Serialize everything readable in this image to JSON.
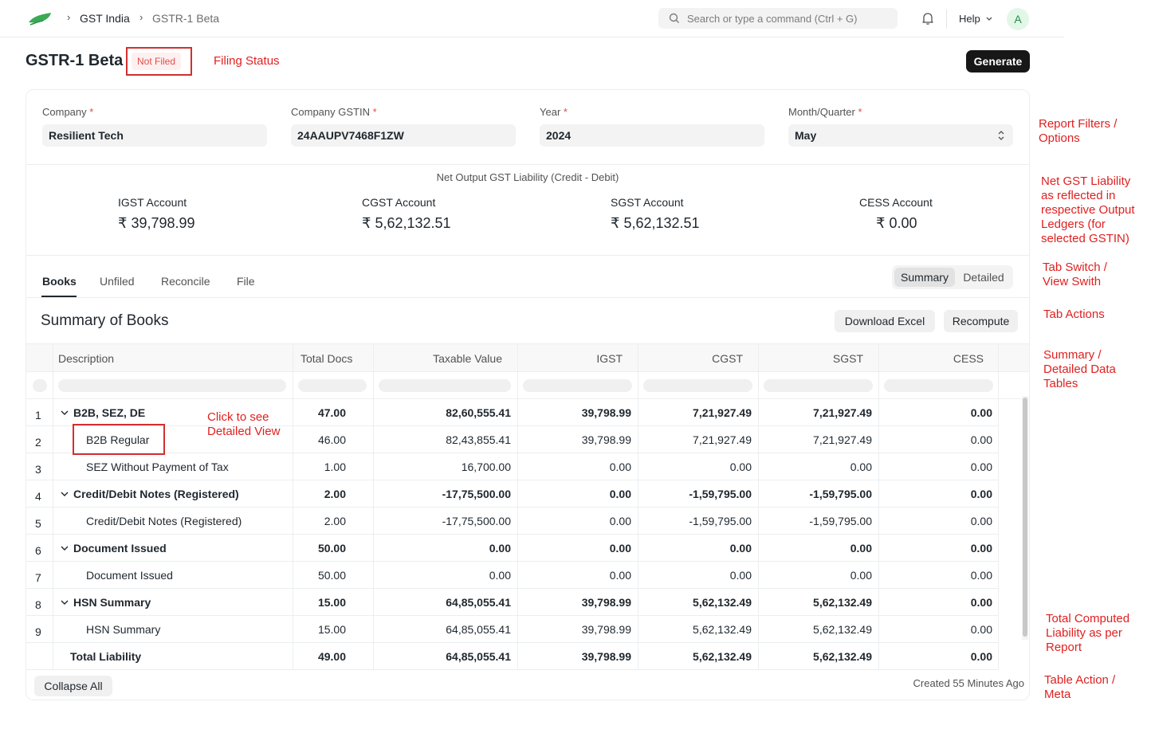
{
  "breadcrumb": {
    "items": [
      "GST India",
      "GSTR-1 Beta"
    ]
  },
  "search": {
    "placeholder": "Search or type a command (Ctrl + G)"
  },
  "nav": {
    "help_label": "Help",
    "avatar_initial": "A"
  },
  "page": {
    "title": "GSTR-1 Beta",
    "status": "Not Filed",
    "generate_label": "Generate"
  },
  "filters": [
    {
      "label": "Company",
      "value": "Resilient Tech"
    },
    {
      "label": "Company GSTIN",
      "value": "24AAUPV7468F1ZW"
    },
    {
      "label": "Year",
      "value": "2024"
    },
    {
      "label": "Month/Quarter",
      "value": "May"
    }
  ],
  "required_marker": "*",
  "liability": {
    "title": "Net Output GST Liability (Credit - Debit)",
    "accounts": [
      {
        "label": "IGST Account",
        "value": "₹ 39,798.99"
      },
      {
        "label": "CGST Account",
        "value": "₹ 5,62,132.51"
      },
      {
        "label": "SGST Account",
        "value": "₹ 5,62,132.51"
      },
      {
        "label": "CESS Account",
        "value": "₹ 0.00"
      }
    ]
  },
  "tabs": [
    "Books",
    "Unfiled",
    "Reconcile",
    "File"
  ],
  "view_toggle": [
    "Summary",
    "Detailed"
  ],
  "summary": {
    "title": "Summary of Books",
    "download_label": "Download Excel",
    "recompute_label": "Recompute"
  },
  "table": {
    "columns": [
      "Description",
      "Total Docs",
      "Taxable Value",
      "IGST",
      "CGST",
      "SGST",
      "CESS"
    ],
    "rows": [
      {
        "n": "1",
        "desc": "B2B, SEZ, DE",
        "docs": "47.00",
        "taxable": "82,60,555.41",
        "igst": "39,798.99",
        "cgst": "7,21,927.49",
        "sgst": "7,21,927.49",
        "cess": "0.00"
      },
      {
        "n": "2",
        "desc": "B2B Regular",
        "docs": "46.00",
        "taxable": "82,43,855.41",
        "igst": "39,798.99",
        "cgst": "7,21,927.49",
        "sgst": "7,21,927.49",
        "cess": "0.00"
      },
      {
        "n": "3",
        "desc": "SEZ Without Payment of Tax",
        "docs": "1.00",
        "taxable": "16,700.00",
        "igst": "0.00",
        "cgst": "0.00",
        "sgst": "0.00",
        "cess": "0.00"
      },
      {
        "n": "4",
        "desc": "Credit/Debit Notes (Registered)",
        "docs": "2.00",
        "taxable": "-17,75,500.00",
        "igst": "0.00",
        "cgst": "-1,59,795.00",
        "sgst": "-1,59,795.00",
        "cess": "0.00"
      },
      {
        "n": "5",
        "desc": "Credit/Debit Notes (Registered)",
        "docs": "2.00",
        "taxable": "-17,75,500.00",
        "igst": "0.00",
        "cgst": "-1,59,795.00",
        "sgst": "-1,59,795.00",
        "cess": "0.00"
      },
      {
        "n": "6",
        "desc": "Document Issued",
        "docs": "50.00",
        "taxable": "0.00",
        "igst": "0.00",
        "cgst": "0.00",
        "sgst": "0.00",
        "cess": "0.00"
      },
      {
        "n": "7",
        "desc": "Document Issued",
        "docs": "50.00",
        "taxable": "0.00",
        "igst": "0.00",
        "cgst": "0.00",
        "sgst": "0.00",
        "cess": "0.00"
      },
      {
        "n": "8",
        "desc": "HSN Summary",
        "docs": "15.00",
        "taxable": "64,85,055.41",
        "igst": "39,798.99",
        "cgst": "5,62,132.49",
        "sgst": "5,62,132.49",
        "cess": "0.00"
      },
      {
        "n": "9",
        "desc": "HSN Summary",
        "docs": "15.00",
        "taxable": "64,85,055.41",
        "igst": "39,798.99",
        "cgst": "5,62,132.49",
        "sgst": "5,62,132.49",
        "cess": "0.00"
      }
    ],
    "total": {
      "desc": "Total Liability",
      "docs": "49.00",
      "taxable": "64,85,055.41",
      "igst": "39,798.99",
      "cgst": "5,62,132.49",
      "sgst": "5,62,132.49",
      "cess": "0.00"
    }
  },
  "footer": {
    "collapse_label": "Collapse All",
    "meta": "Created 55 Minutes Ago"
  },
  "annotations": {
    "filing_status": "Filing Status",
    "report_filters": [
      "Report Filters /",
      "Options"
    ],
    "net_liability": [
      "Net GST Liability",
      "as reflected in",
      "respective Output",
      "Ledgers (for",
      "selected GSTIN)"
    ],
    "tab_switch": [
      "Tab Switch /",
      "View Swith"
    ],
    "tab_actions": "Tab Actions",
    "data_tables": [
      "Summary /",
      "Detailed Data",
      "Tables"
    ],
    "click_detail": [
      "Click to see",
      "Detailed View"
    ],
    "total_liability": [
      "Total Computed",
      "Liability as per",
      "Report"
    ],
    "table_meta": [
      "Table Action /",
      "Meta"
    ]
  },
  "colors": {
    "accent_dark": "#171717",
    "annotation_red": "#e02020",
    "status_red": "#e24c4c",
    "logo_green": "#3aaa55"
  },
  "icons": [
    "logo-icon",
    "chevron-right-icon",
    "search-icon",
    "bell-icon",
    "chevron-down-icon",
    "select-arrows-icon"
  ]
}
